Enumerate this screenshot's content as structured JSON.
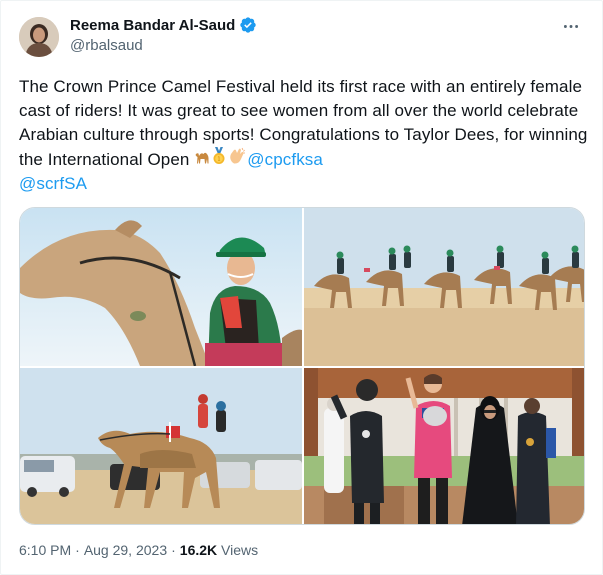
{
  "author": {
    "name": "Reema Bandar Al-Saud",
    "handle": "@rbalsaud",
    "verified_color": "#1d9bf0"
  },
  "more_icon": "more-horizontal-icon",
  "tweet": {
    "text_part1": "The Crown Prince Camel Festival held its first race with an entirely female cast of riders! It was great to see women from all over the world celebrate Arabian culture through sports! Congratulations to Taylor Dees, for winning the International Open ",
    "emojis": [
      "camel-emoji",
      "gold-medal-emoji",
      "clapping-hands-emoji"
    ],
    "mention1": "@cpcfksa",
    "mention2": "@scrfSA"
  },
  "media": [
    {
      "name": "photo-rider-closeup"
    },
    {
      "name": "photo-camel-race-group"
    },
    {
      "name": "photo-camel-race-jockeys"
    },
    {
      "name": "photo-podium-winners"
    }
  ],
  "meta": {
    "time": "6:10 PM",
    "date": "Aug 29, 2023",
    "separator": "·",
    "views_count": "16.2K",
    "views_label": "Views"
  },
  "colors": {
    "link": "#1d9bf0",
    "secondary_text": "#536471",
    "primary_text": "#0f1419"
  }
}
